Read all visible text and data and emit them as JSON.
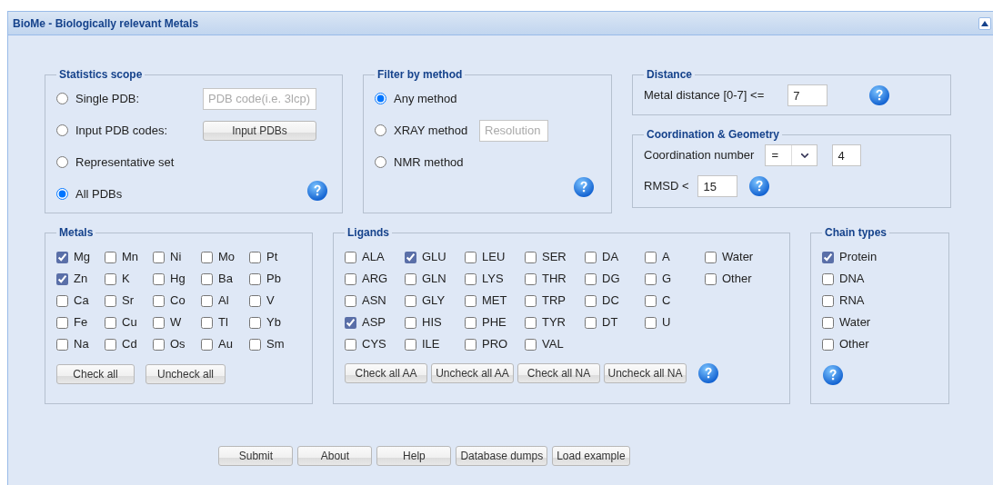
{
  "window": {
    "title": "BioMe - Biologically relevant Metals",
    "collapsed": false
  },
  "scope": {
    "legend": "Statistics scope",
    "options": [
      {
        "label": "Single PDB:",
        "selected": false,
        "kind": "field",
        "placeholder": "PDB code(i.e. 3lcp)"
      },
      {
        "label": "Input PDB codes:",
        "selected": false,
        "kind": "button",
        "button": "Input PDBs"
      },
      {
        "label": "Representative set",
        "selected": false,
        "kind": "plain"
      },
      {
        "label": "All PDBs",
        "selected": true,
        "kind": "plain"
      }
    ]
  },
  "method": {
    "legend": "Filter by method",
    "options": [
      {
        "label": "Any method",
        "selected": true,
        "kind": "plain"
      },
      {
        "label": "XRAY method",
        "selected": false,
        "kind": "field",
        "placeholder": "Resolution"
      },
      {
        "label": "NMR method",
        "selected": false,
        "kind": "plain"
      }
    ]
  },
  "distance": {
    "legend": "Distance",
    "label": "Metal distance [0-7] <=",
    "value": "7"
  },
  "coordination": {
    "legend": "Coordination & Geometry",
    "number_label": "Coordination number",
    "operator": "=",
    "number": "4",
    "rmsd_label": "RMSD <",
    "rmsd": "15"
  },
  "metals": {
    "legend": "Metals",
    "items": [
      {
        "label": "Mg",
        "checked": true
      },
      {
        "label": "Mn",
        "checked": false
      },
      {
        "label": "Ni",
        "checked": false
      },
      {
        "label": "Mo",
        "checked": false
      },
      {
        "label": "Pt",
        "checked": false
      },
      {
        "label": "Zn",
        "checked": true
      },
      {
        "label": "K",
        "checked": false
      },
      {
        "label": "Hg",
        "checked": false
      },
      {
        "label": "Ba",
        "checked": false
      },
      {
        "label": "Pb",
        "checked": false
      },
      {
        "label": "Ca",
        "checked": false
      },
      {
        "label": "Sr",
        "checked": false
      },
      {
        "label": "Co",
        "checked": false
      },
      {
        "label": "Al",
        "checked": false
      },
      {
        "label": "V",
        "checked": false
      },
      {
        "label": "Fe",
        "checked": false
      },
      {
        "label": "Cu",
        "checked": false
      },
      {
        "label": "W",
        "checked": false
      },
      {
        "label": "Tl",
        "checked": false
      },
      {
        "label": "Yb",
        "checked": false
      },
      {
        "label": "Na",
        "checked": false
      },
      {
        "label": "Cd",
        "checked": false
      },
      {
        "label": "Os",
        "checked": false
      },
      {
        "label": "Au",
        "checked": false
      },
      {
        "label": "Sm",
        "checked": false
      }
    ],
    "buttons": [
      "Check all",
      "Uncheck all"
    ]
  },
  "ligands": {
    "legend": "Ligands",
    "columns": [
      {
        "items": [
          {
            "label": "ALA",
            "checked": false
          },
          {
            "label": "ARG",
            "checked": false
          },
          {
            "label": "ASN",
            "checked": false
          },
          {
            "label": "ASP",
            "checked": true
          },
          {
            "label": "CYS",
            "checked": false
          }
        ]
      },
      {
        "items": [
          {
            "label": "GLU",
            "checked": true
          },
          {
            "label": "GLN",
            "checked": false
          },
          {
            "label": "GLY",
            "checked": false
          },
          {
            "label": "HIS",
            "checked": false
          },
          {
            "label": "ILE",
            "checked": false
          }
        ]
      },
      {
        "items": [
          {
            "label": "LEU",
            "checked": false
          },
          {
            "label": "LYS",
            "checked": false
          },
          {
            "label": "MET",
            "checked": false
          },
          {
            "label": "PHE",
            "checked": false
          },
          {
            "label": "PRO",
            "checked": false
          }
        ]
      },
      {
        "items": [
          {
            "label": "SER",
            "checked": false
          },
          {
            "label": "THR",
            "checked": false
          },
          {
            "label": "TRP",
            "checked": false
          },
          {
            "label": "TYR",
            "checked": false
          },
          {
            "label": "VAL",
            "checked": false
          }
        ]
      },
      {
        "items": [
          {
            "label": "DA",
            "checked": false
          },
          {
            "label": "DG",
            "checked": false
          },
          {
            "label": "DC",
            "checked": false
          },
          {
            "label": "DT",
            "checked": false
          }
        ]
      },
      {
        "items": [
          {
            "label": "A",
            "checked": false
          },
          {
            "label": "G",
            "checked": false
          },
          {
            "label": "C",
            "checked": false
          },
          {
            "label": "U",
            "checked": false
          }
        ]
      },
      {
        "items": [
          {
            "label": "Water",
            "checked": false
          },
          {
            "label": "Other",
            "checked": false
          }
        ]
      }
    ],
    "buttons": [
      "Check all AA",
      "Uncheck all AA",
      "Check all NA",
      "Uncheck all NA"
    ]
  },
  "chain_types": {
    "legend": "Chain types",
    "items": [
      {
        "label": "Protein",
        "checked": true
      },
      {
        "label": "DNA",
        "checked": false
      },
      {
        "label": "RNA",
        "checked": false
      },
      {
        "label": "Water",
        "checked": false
      },
      {
        "label": "Other",
        "checked": false
      }
    ]
  },
  "buttons": [
    "Submit",
    "About",
    "Help",
    "Database dumps",
    "Load example"
  ]
}
